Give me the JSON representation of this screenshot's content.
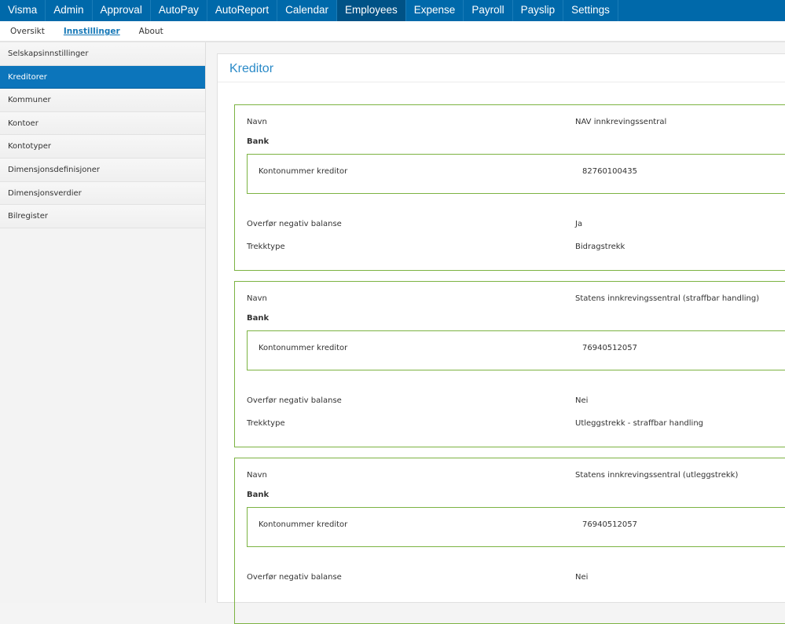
{
  "topnav": {
    "items": [
      "Visma",
      "Admin",
      "Approval",
      "AutoPay",
      "AutoReport",
      "Calendar",
      "Employees",
      "Expense",
      "Payroll",
      "Payslip",
      "Settings"
    ],
    "active": "Employees"
  },
  "subnav": {
    "items": [
      "Oversikt",
      "Innstillinger",
      "About"
    ],
    "active": "Innstillinger"
  },
  "sidebar": {
    "items": [
      "Selskapsinnstillinger",
      "Kreditorer",
      "Kommuner",
      "Kontoer",
      "Kontotyper",
      "Dimensjonsdefinisjoner",
      "Dimensjonsverdier",
      "Bilregister"
    ],
    "active": "Kreditorer"
  },
  "main": {
    "title": "Kreditor",
    "labels": {
      "name": "Navn",
      "bank": "Bank",
      "account": "Kontonummer kreditor",
      "negative": "Overfør negativ balanse",
      "type": "Trekktype"
    },
    "creditors": [
      {
        "name": "NAV innkrevingssentral",
        "account": "82760100435",
        "negative": "Ja",
        "type": "Bidragstrekk"
      },
      {
        "name": "Statens innkrevingssentral (straffbar handling)",
        "account": "76940512057",
        "negative": "Nei",
        "type": "Utleggstrekk - straffbar handling"
      },
      {
        "name": "Statens innkrevingssentral (utleggstrekk)",
        "account": "76940512057",
        "negative": "Nei"
      }
    ]
  },
  "colors": {
    "nav": "#0069aa",
    "nav_active": "#005286",
    "accent": "#0c75bb",
    "card_border": "#7cb342"
  }
}
